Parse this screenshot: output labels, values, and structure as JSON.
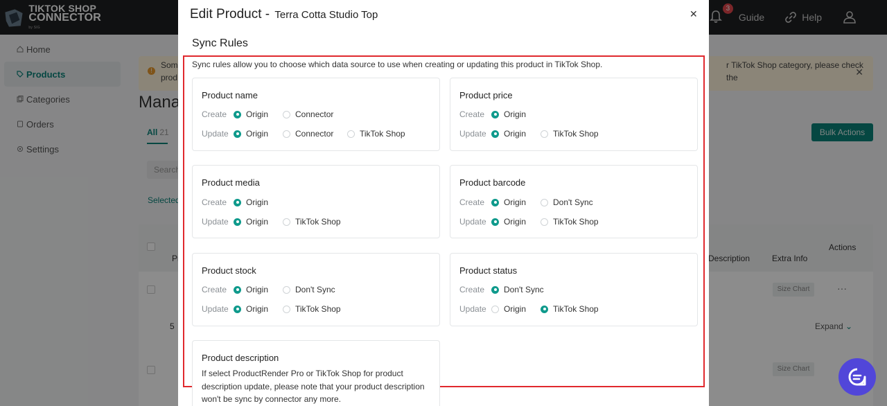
{
  "app": {
    "logo_line1": "TIKTOK SHOP",
    "logo_line2": "CONNECTOR",
    "logo_line3": "by SIG",
    "notification_count": "3",
    "nav_guide": "Guide",
    "nav_help": "Help"
  },
  "sidebar": {
    "items": [
      {
        "label": "Home"
      },
      {
        "label": "Products"
      },
      {
        "label": "Categories"
      },
      {
        "label": "Orders"
      },
      {
        "label": "Settings"
      }
    ]
  },
  "main": {
    "notice_left": "Some prod",
    "notice_right": "r TikTok Shop category, please check the",
    "page_title": "Mana",
    "tab_all": "All",
    "tab_all_count": "21",
    "bulk_actions": "Bulk Actions",
    "search_placeholder": "Search",
    "selected_label": "Selected",
    "col_p": "Pr",
    "col_description": "Description",
    "col_extra_info": "Extra Info",
    "col_actions": "Actions",
    "size_chart": "Size Chart",
    "row_dots": "···",
    "expand": "Expand",
    "row_num": "5"
  },
  "modal": {
    "title": "Edit Product -",
    "product_name": "Terra Cotta Studio Top",
    "section_title": "Sync Rules",
    "intro": "Sync rules allow you to choose which data source to use when creating or updating this product in TikTok Shop.",
    "create_label": "Create",
    "update_label": "Update",
    "cards": [
      {
        "title": "Product name",
        "create": [
          {
            "label": "Origin",
            "selected": true
          },
          {
            "label": "Connector",
            "selected": false
          }
        ],
        "update": [
          {
            "label": "Origin",
            "selected": true
          },
          {
            "label": "Connector",
            "selected": false
          },
          {
            "label": "TikTok Shop",
            "selected": false
          }
        ]
      },
      {
        "title": "Product price",
        "create": [
          {
            "label": "Origin",
            "selected": true
          }
        ],
        "update": [
          {
            "label": "Origin",
            "selected": true
          },
          {
            "label": "TikTok Shop",
            "selected": false
          }
        ]
      },
      {
        "title": "Product media",
        "create": [
          {
            "label": "Origin",
            "selected": true
          }
        ],
        "update": [
          {
            "label": "Origin",
            "selected": true
          },
          {
            "label": "TikTok Shop",
            "selected": false
          }
        ]
      },
      {
        "title": "Product barcode",
        "create": [
          {
            "label": "Origin",
            "selected": true
          },
          {
            "label": "Don't Sync",
            "selected": false
          }
        ],
        "update": [
          {
            "label": "Origin",
            "selected": true
          },
          {
            "label": "TikTok Shop",
            "selected": false
          }
        ]
      },
      {
        "title": "Product stock",
        "create": [
          {
            "label": "Origin",
            "selected": true
          },
          {
            "label": "Don't Sync",
            "selected": false
          }
        ],
        "update": [
          {
            "label": "Origin",
            "selected": true
          },
          {
            "label": "TikTok Shop",
            "selected": false
          }
        ]
      },
      {
        "title": "Product status",
        "create": [
          {
            "label": "Don't Sync",
            "selected": true
          }
        ],
        "update": [
          {
            "label": "Origin",
            "selected": false
          },
          {
            "label": "TikTok Shop",
            "selected": true
          }
        ]
      }
    ],
    "description_card": {
      "title": "Product description",
      "text": "If select ProductRender Pro or TikTok Shop for product description update, please note that your product description won't be sync by connector any more."
    }
  },
  "colors": {
    "accent": "#0f9a8c",
    "highlight_frame": "#e0282d",
    "chat": "#5146d9"
  }
}
